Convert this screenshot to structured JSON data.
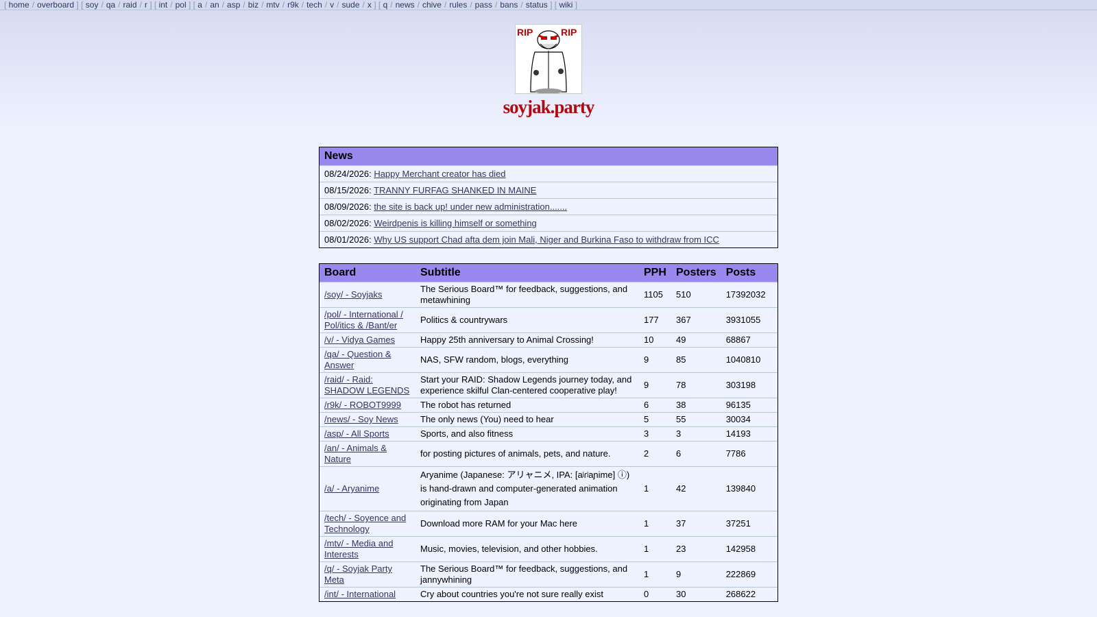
{
  "topnav": {
    "groups": [
      [
        "home",
        "overboard"
      ],
      [
        "soy",
        "qa",
        "raid",
        "r"
      ],
      [
        "int",
        "pol"
      ],
      [
        "a",
        "an",
        "asp",
        "biz",
        "mtv",
        "r9k",
        "tech",
        "v",
        "sude",
        "x"
      ],
      [
        "q",
        "news",
        "chive",
        "rules",
        "pass",
        "bans",
        "status"
      ],
      [
        "wiki"
      ]
    ]
  },
  "banner_text": "RIP RIP",
  "site_title": "soyjak.party",
  "news": {
    "heading": "News",
    "items": [
      {
        "date": "08/24/2026:",
        "title": "Happy Merchant creator has died"
      },
      {
        "date": "08/15/2026:",
        "title": "TRANNY FURFAG SHANKED IN MAINE"
      },
      {
        "date": "08/09/2026:",
        "title": "the site is back up! under new administration......."
      },
      {
        "date": "08/02/2026:",
        "title": "Weirdpenis is killing himself or something"
      },
      {
        "date": "08/01/2026:",
        "title": "Why US support Chad afta dem join Mali, Niger and Burkina Faso to withdraw from ICC"
      }
    ]
  },
  "boards": {
    "headers": {
      "board": "Board",
      "subtitle": "Subtitle",
      "pph": "PPH",
      "posters": "Posters",
      "posts": "Posts"
    },
    "rows": [
      {
        "board": "/soy/ - Soyjaks",
        "subtitle": "The Serious Board™ for feedback, suggestions, and metawhining",
        "pph": "1105",
        "posters": "510",
        "posts": "17392032"
      },
      {
        "board": "/pol/ - International / Pol/itics & /Bant/er",
        "subtitle": "Politics & countrywars",
        "pph": "177",
        "posters": "367",
        "posts": "3931055"
      },
      {
        "board": "/v/ - Vidya Games",
        "subtitle": "Happy 25th anniversary to Animal Crossing!",
        "pph": "10",
        "posters": "49",
        "posts": "68867"
      },
      {
        "board": "/qa/ - Question & Answer",
        "subtitle": "NAS, SFW random, blogs, everything",
        "pph": "9",
        "posters": "85",
        "posts": "1040810"
      },
      {
        "board": "/raid/ - Raid: SHADOW LEGENDS",
        "subtitle": "Start your RAID: Shadow Legends journey today, and experience skilful Clan-centered cooperative play!",
        "pph": "9",
        "posters": "78",
        "posts": "303198"
      },
      {
        "board": "/r9k/ - ROBOT9999",
        "subtitle": "The robot has returned",
        "pph": "6",
        "posters": "38",
        "posts": "96135"
      },
      {
        "board": "/news/ - Soy News",
        "subtitle": "The only news (You) need to hear",
        "pph": "5",
        "posters": "55",
        "posts": "30034"
      },
      {
        "board": "/asp/ - All Sports",
        "subtitle": "Sports, and also fitness",
        "pph": "3",
        "posters": "3",
        "posts": "14193"
      },
      {
        "board": "/an/ - Animals & Nature",
        "subtitle": "for posting pictures of animals, pets, and nature.",
        "pph": "2",
        "posters": "6",
        "posts": "7786"
      },
      {
        "board": "/a/ - Aryanime",
        "subtitle": "Aryanime (Japanese: アリャニメ, IPA: [aʲɾʲaɲime] ⓘ) is hand-drawn and computer-generated animation originating from Japan",
        "pph": "1",
        "posters": "42",
        "posts": "139840"
      },
      {
        "board": "/tech/ - Soyence and Technology",
        "subtitle": "Download more RAM for your Mac here",
        "pph": "1",
        "posters": "37",
        "posts": "37251"
      },
      {
        "board": "/mtv/ - Media and Interests",
        "subtitle": "Music, movies, television, and other hobbies.",
        "pph": "1",
        "posters": "23",
        "posts": "142958"
      },
      {
        "board": "/q/ - Soyjak Party Meta",
        "subtitle": "The Serious Board™ for feedback, suggestions, and jannywhining",
        "pph": "1",
        "posters": "9",
        "posts": "222869"
      },
      {
        "board": "/int/ - International",
        "subtitle": "Cry about countries you're not sure really exist",
        "pph": "0",
        "posters": "30",
        "posts": "268622"
      }
    ]
  }
}
